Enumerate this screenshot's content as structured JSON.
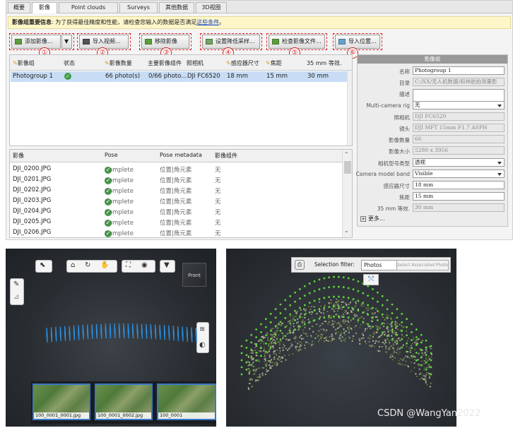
{
  "tabs": [
    "概要",
    "影像",
    "Point clouds",
    "Surveys",
    "其他数据",
    "3D视图"
  ],
  "info": {
    "title": "影像组重要信息",
    "text": ": 为了获得最佳精度和性能，请检查您输入的数据是否满足",
    "link": "这些条件",
    "tail": "。"
  },
  "toolbar": [
    {
      "label": "添加影像...",
      "num": "①"
    },
    {
      "label": "导入视频...",
      "num": "②"
    },
    {
      "label": "移除影像",
      "num": "③"
    },
    {
      "label": "设置降低采样...",
      "num": "④"
    },
    {
      "label": "检查影像文件...",
      "num": "⑤"
    },
    {
      "label": "导入位置...",
      "num": "⑥"
    }
  ],
  "groups": {
    "headers": [
      "影像组",
      "状态",
      "影像数量",
      "主要影像组件",
      "照相机",
      "感应器尺寸",
      "焦距",
      "35 mm 等效."
    ],
    "row": {
      "name": "Photogroup 1",
      "status": "✓",
      "count": "66 photo(s)",
      "main": "0/66 photo...",
      "camera": "DJI FC6520",
      "sensor": "18 mm",
      "focal": "15 mm",
      "eq": "30 mm"
    }
  },
  "photos": {
    "headers": [
      "影像",
      "Pose",
      "Pose metadata",
      "影像组件"
    ],
    "rows": [
      {
        "name": "DJI_0200.JPG",
        "pose": "Complete",
        "meta": "位置|角元素",
        "comp": "无"
      },
      {
        "name": "DJI_0201.JPG",
        "pose": "Complete",
        "meta": "位置|角元素",
        "comp": "无"
      },
      {
        "name": "DJI_0202.JPG",
        "pose": "Complete",
        "meta": "位置|角元素",
        "comp": "无"
      },
      {
        "name": "DJI_0203.JPG",
        "pose": "Complete",
        "meta": "位置|角元素",
        "comp": "无"
      },
      {
        "name": "DJI_0204.JPG",
        "pose": "Complete",
        "meta": "位置|角元素",
        "comp": "无"
      },
      {
        "name": "DJI_0205.JPG",
        "pose": "Complete",
        "meta": "位置|角元素",
        "comp": "无"
      },
      {
        "name": "DJI_0206.JPG",
        "pose": "Complete",
        "meta": "位置|角元素",
        "comp": "无"
      }
    ]
  },
  "panel": {
    "title": "影像组",
    "fields": [
      {
        "label": "名称",
        "value": "Photogroup 1",
        "kind": "edit"
      },
      {
        "label": "目录",
        "value": "C:/XX/无人机数据/和林航拍测量影",
        "kind": "dis"
      },
      {
        "label": "描述",
        "value": "",
        "kind": "edit"
      },
      {
        "label": "Multi-camera rig",
        "value": "无",
        "kind": "sel"
      },
      {
        "label": "照相机",
        "value": "DJI FC6520",
        "kind": "dis"
      },
      {
        "label": "镜头",
        "value": "DJI MFT 15mm F1.7 ASPH",
        "kind": "dis"
      },
      {
        "label": "影像数量",
        "value": "66",
        "kind": "dis"
      },
      {
        "label": "影像大小",
        "value": "5280 x 3956",
        "kind": "dis"
      },
      {
        "label": "相机型号类型",
        "value": "透视",
        "kind": "sel"
      },
      {
        "label": "Camera model band",
        "value": "Visible",
        "kind": "sel"
      },
      {
        "label": "感应器尺寸",
        "value": "18 mm",
        "kind": "edit"
      },
      {
        "label": "焦距",
        "value": "15 mm",
        "kind": "edit"
      },
      {
        "label": "35 mm 等效.",
        "value": "30 mm",
        "kind": "dis"
      }
    ],
    "more": "更多..."
  },
  "viewer": {
    "cube": "Front",
    "thumbs": [
      "100_0001_0001.jpg",
      "100_0001_0002.jpg",
      "100_0001"
    ]
  },
  "pointcloud": {
    "filter_label": "Selection filter:",
    "filter_value": "Photos",
    "assoc_button": "Select Associated Photos"
  },
  "watermark": "CSDN @WangYan2022"
}
